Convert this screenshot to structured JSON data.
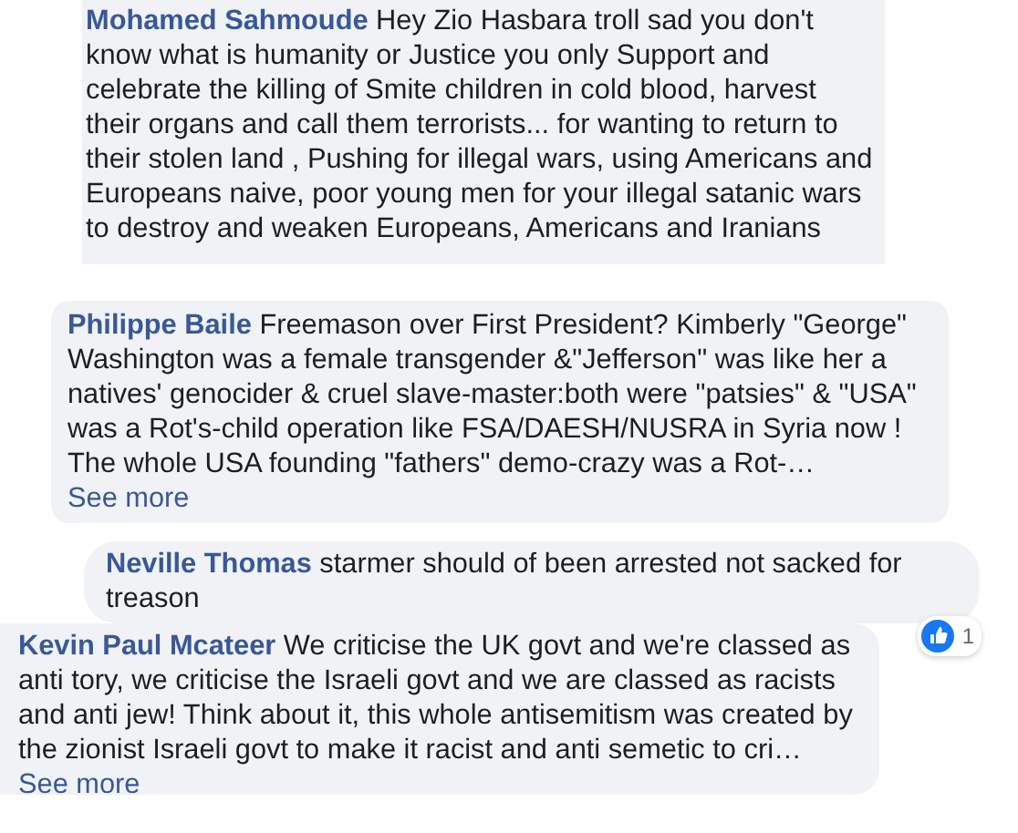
{
  "comments": [
    {
      "author": "Mohamed Sahmoude",
      "text": "Hey Zio Hasbara troll sad you don't know what is humanity or Justice you only Support and celebrate the killing of Smite children in cold blood, harvest their organs and call them terrorists... for wanting to return to their stolen land , Pushing for illegal wars, using Americans and Europeans naive, poor young men for your illegal satanic wars to destroy and weaken Europeans, Americans and Iranians"
    },
    {
      "author": "Philippe Baile",
      "text": "Freemason over First President? Kimberly \"George\" Washington was a female transgender &\"Jefferson\" was like her a natives' genocider & cruel slave-master:both were \"patsies\" & \"USA\" was a Rot's-child operation like FSA/DAESH/NUSRA in Syria now ! The whole USA founding \"fathers\" demo-crazy was a Rot-…",
      "see_more": "See more"
    },
    {
      "author": "Neville Thomas",
      "text": "starmer should of been arrested not sacked for treason",
      "reactions": "1"
    },
    {
      "author": "Kevin Paul Mcateer",
      "text": "We criticise the UK govt and we're classed as anti tory, we criticise the Israeli govt and we are classed as racists and anti jew! Think about it, this whole antisemitism was created by the zionist Israeli govt to make it racist and anti semetic to cri…",
      "see_more": "See more"
    }
  ]
}
